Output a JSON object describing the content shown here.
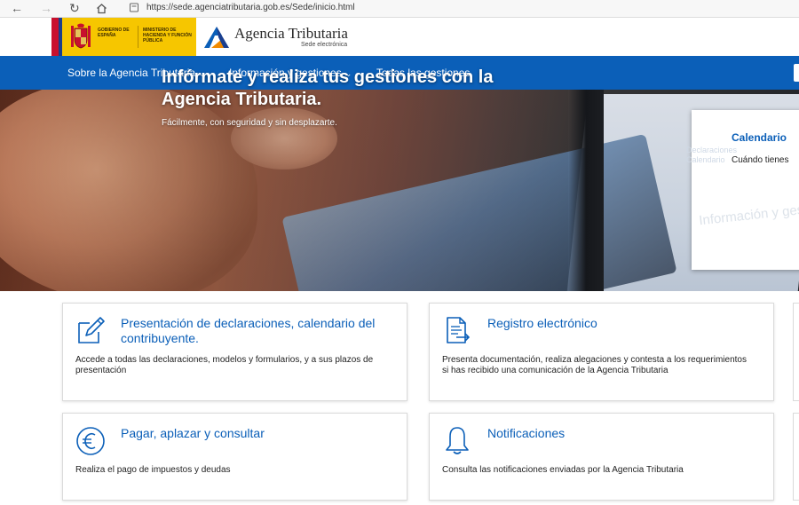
{
  "browser": {
    "url": "https://sede.agenciatributaria.gob.es/Sede/inicio.html",
    "icons": [
      "back-arrow-icon",
      "forward-arrow-icon",
      "reload-icon",
      "home-icon",
      "lock-icon"
    ]
  },
  "header": {
    "gov_text": "GOBIERNO DE ESPAÑA",
    "ministry_text": "MINISTERIO DE HACIENDA Y FUNCIÓN PÚBLICA",
    "brand_name": "Agencia Tributaria",
    "brand_sub": "Sede electrónica"
  },
  "nav": {
    "items": [
      {
        "label": "Sobre la Agencia Tributaria",
        "dropdown": true
      },
      {
        "label": "Información y gestiones",
        "dropdown": true
      },
      {
        "label": "Todas las gestiones",
        "dropdown": false
      }
    ],
    "chevron": "⌄"
  },
  "hero": {
    "title": "Infórmate y realiza tus gestiones con la Agencia Tributaria.",
    "subtitle": "Fácilmente, con seguridad y sin desplazarte."
  },
  "calendar_card": {
    "title": "Calendario",
    "subtitle": "Cuándo tienes",
    "ghost_text": "Información y gestiones",
    "ghost_small": "Declaraciones\nCalendario"
  },
  "cards": [
    {
      "title": "Presentación de declaraciones, calendario del contribuyente.",
      "description": "Accede a todas las declaraciones, modelos y formularios, y a sus plazos de presentación",
      "icon": "edit-document-icon"
    },
    {
      "title": "Registro electrónico",
      "description": "Presenta documentación, realiza alegaciones y contesta a los requerimientos si has recibido una comunicación de la Agencia Tributaria",
      "icon": "register-document-icon"
    },
    {
      "title": "Pagar, aplazar y consultar",
      "description": "Realiza el pago de impuestos y deudas",
      "icon": "euro-icon"
    },
    {
      "title": "Notificaciones",
      "description": "Consulta las notificaciones enviadas por la Agencia Tributaria",
      "icon": "bell-icon"
    }
  ],
  "colors": {
    "brand_blue": "#0b5fb8",
    "gov_yellow": "#f6c600",
    "spain_red": "#c8102e"
  }
}
